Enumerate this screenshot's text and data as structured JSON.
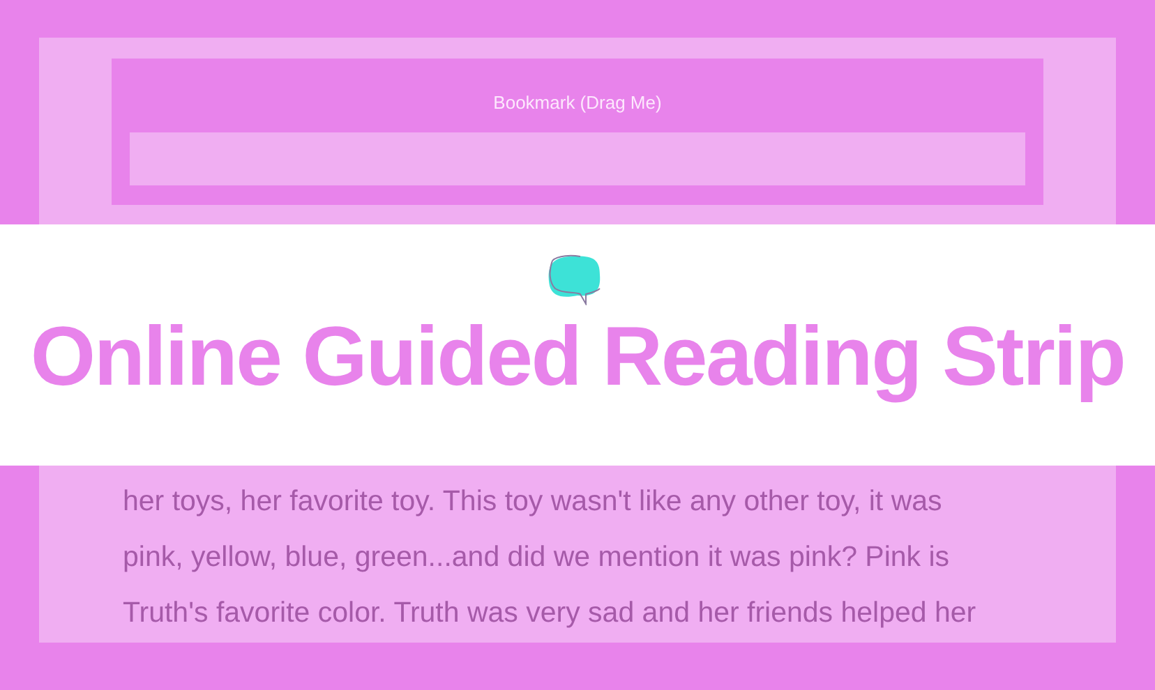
{
  "bookmark": {
    "label": "Bookmark (Drag Me)"
  },
  "header": {
    "title": "Online Guided Reading Strip"
  },
  "reading_text": {
    "lines": [
      "her toys, her favorite toy. This toy wasn't like any other toy, it was",
      "pink, yellow, blue, green...and did we mention it was pink? Pink is",
      "Truth's favorite color. Truth was very sad and her friends helped her"
    ]
  }
}
